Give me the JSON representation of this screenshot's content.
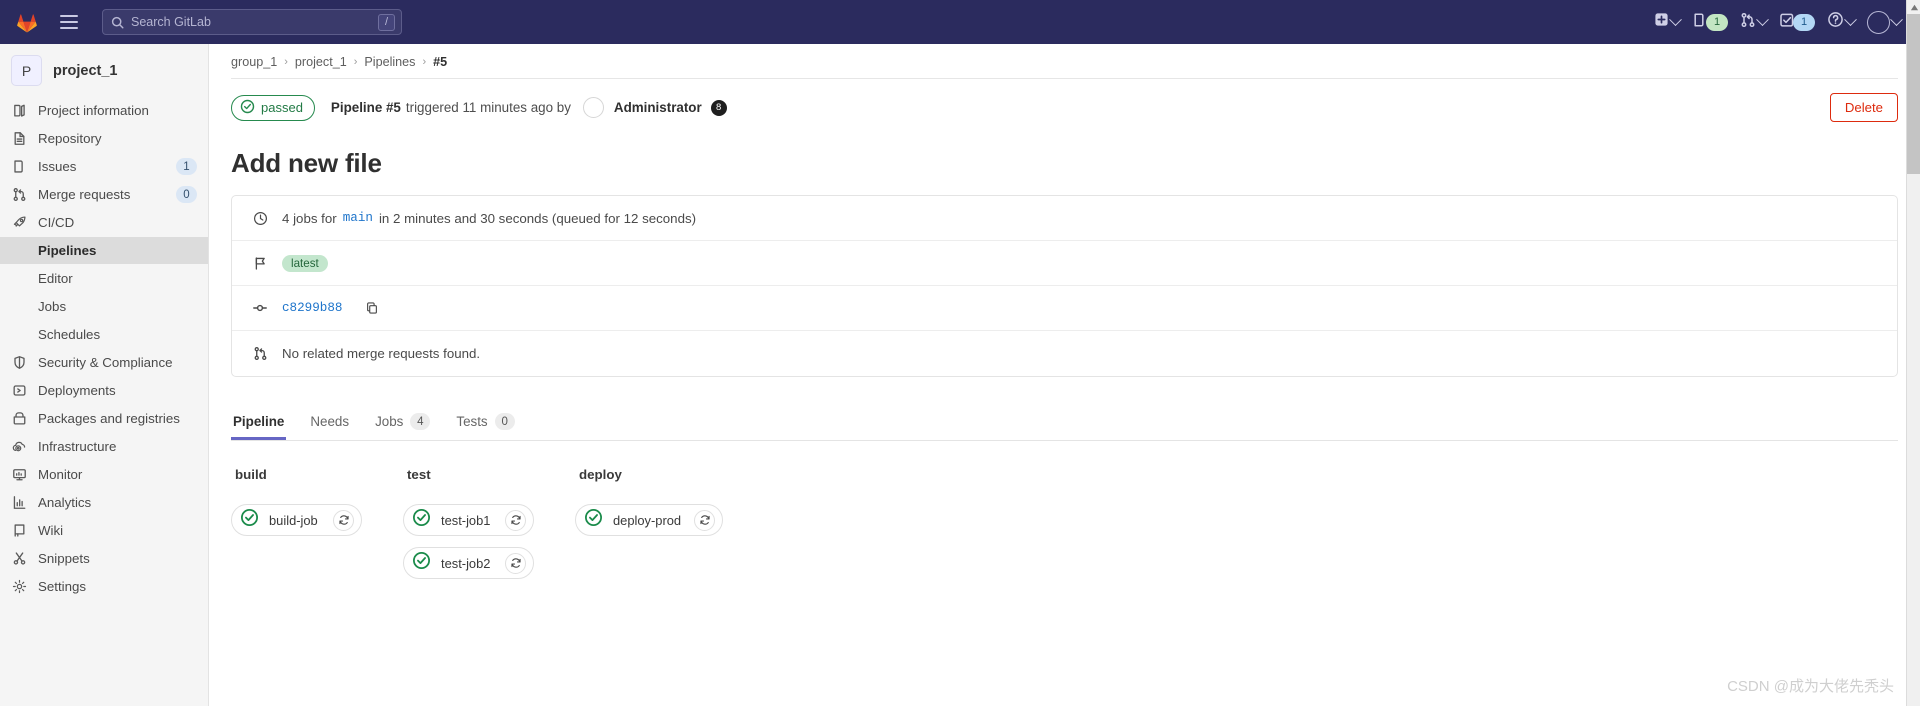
{
  "navbar": {
    "logo_icon": "gitlab-logo-icon",
    "hamburger_icon": "hamburger-menu-icon",
    "search": {
      "icon": "search-icon",
      "placeholder": "Search GitLab",
      "value": "",
      "shortcut_key": "/"
    },
    "right_items": [
      {
        "icon": "plus-square-icon",
        "label": "",
        "badge": "",
        "has_chevron": true
      },
      {
        "icon": "issues-icon",
        "label": "",
        "badge": "1",
        "badge_style": "green",
        "has_chevron": false
      },
      {
        "icon": "merge-requests-icon",
        "label": "",
        "badge": "",
        "has_chevron": true
      },
      {
        "icon": "todos-checkbox-icon",
        "label": "",
        "badge": "1",
        "badge_style": "blue",
        "has_chevron": false
      },
      {
        "icon": "help-question-icon",
        "label": "",
        "badge": "",
        "has_chevron": true
      },
      {
        "icon": "user-avatar-icon",
        "label": "",
        "badge": "",
        "has_chevron": true
      }
    ]
  },
  "sidebar": {
    "project": {
      "initial": "P",
      "name": "project_1"
    },
    "items": [
      {
        "icon": "project-information-icon",
        "label": "Project information",
        "count": null
      },
      {
        "icon": "repository-icon",
        "label": "Repository",
        "count": null
      },
      {
        "icon": "issues-icon",
        "label": "Issues",
        "count": "1"
      },
      {
        "icon": "merge-requests-icon",
        "label": "Merge requests",
        "count": "0"
      },
      {
        "icon": "rocket-icon",
        "label": "CI/CD",
        "count": null
      }
    ],
    "cicd_subitems": [
      {
        "label": "Pipelines",
        "active": true
      },
      {
        "label": "Editor",
        "active": false
      },
      {
        "label": "Jobs",
        "active": false
      },
      {
        "label": "Schedules",
        "active": false
      }
    ],
    "items_after": [
      {
        "icon": "shield-icon",
        "label": "Security & Compliance",
        "count": null
      },
      {
        "icon": "deployments-icon",
        "label": "Deployments",
        "count": null
      },
      {
        "icon": "package-icon",
        "label": "Packages and registries",
        "count": null
      },
      {
        "icon": "cloud-gear-icon",
        "label": "Infrastructure",
        "count": null
      },
      {
        "icon": "monitor-icon",
        "label": "Monitor",
        "count": null
      },
      {
        "icon": "analytics-chart-icon",
        "label": "Analytics",
        "count": null
      },
      {
        "icon": "book-icon",
        "label": "Wiki",
        "count": null
      },
      {
        "icon": "scissors-icon",
        "label": "Snippets",
        "count": null
      },
      {
        "icon": "gear-icon",
        "label": "Settings",
        "count": null
      }
    ]
  },
  "breadcrumb": {
    "items": [
      "group_1",
      "project_1",
      "Pipelines"
    ],
    "current": "#5",
    "separator": "›"
  },
  "pipeline_header": {
    "status_icon": "check-circle-icon",
    "status_label": "passed",
    "prefix_bold": "Pipeline #5",
    "middle_text": "triggered 11 minutes ago by",
    "avatar_icon": "user-avatar-icon",
    "user_name": "Administrator",
    "user_badge": "8",
    "delete_label": "Delete"
  },
  "page_title": "Add new file",
  "info_card": {
    "rows": [
      {
        "icon": "clock-icon",
        "prefix": "4 jobs for",
        "ref": "main",
        "suffix": "in 2 minutes and 30 seconds (queued for 12 seconds)"
      },
      {
        "icon": "flag-icon",
        "tag": "latest"
      },
      {
        "icon": "commit-icon",
        "sha": "c8299b88",
        "copy_icon": "copy-to-clipboard-icon"
      },
      {
        "icon": "merge-requests-icon",
        "text": "No related merge requests found."
      }
    ]
  },
  "tabs": [
    {
      "label": "Pipeline",
      "count": null,
      "active": true
    },
    {
      "label": "Needs",
      "count": null,
      "active": false
    },
    {
      "label": "Jobs",
      "count": "4",
      "active": false
    },
    {
      "label": "Tests",
      "count": "0",
      "active": false
    }
  ],
  "pipeline_graph": {
    "stages": [
      {
        "name": "build",
        "jobs": [
          {
            "name": "build-job",
            "status_icon": "check-circle-icon",
            "status": "passed",
            "retry_icon": "retry-icon"
          }
        ]
      },
      {
        "name": "test",
        "jobs": [
          {
            "name": "test-job1",
            "status_icon": "check-circle-icon",
            "status": "passed",
            "retry_icon": "retry-icon"
          },
          {
            "name": "test-job2",
            "status_icon": "check-circle-icon",
            "status": "passed",
            "retry_icon": "retry-icon"
          }
        ]
      },
      {
        "name": "deploy",
        "jobs": [
          {
            "name": "deploy-prod",
            "status_icon": "check-circle-icon",
            "status": "passed",
            "retry_icon": "retry-icon"
          }
        ]
      }
    ]
  },
  "watermark": "CSDN @成为大佬先秃头",
  "colors": {
    "navbar_bg": "#2b2b5e",
    "success_green": "#268a4e",
    "link_blue": "#1f75cb",
    "danger_red": "#dd2b0e",
    "tab_active": "#6666c4",
    "sidebar_bg": "#f5f5f5"
  }
}
